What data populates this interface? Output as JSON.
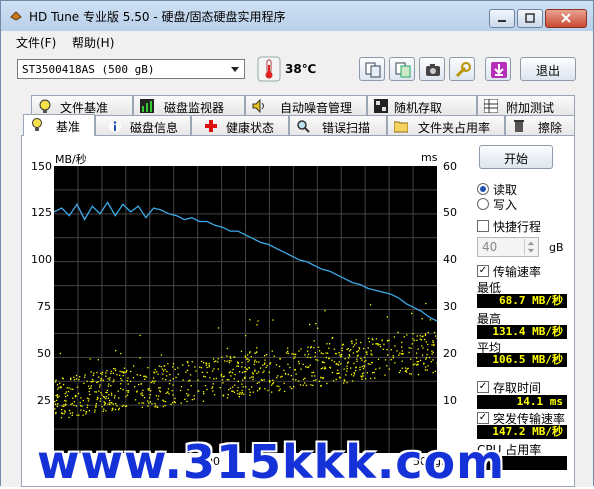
{
  "window": {
    "title": "HD Tune 专业版 5.50 - 硬盘/固态硬盘实用程序"
  },
  "menu": [
    "文件(F)",
    "帮助(H)"
  ],
  "toolbar": {
    "drive": "ST3500418AS (500 gB)",
    "temperature": "38℃",
    "exit_label": "退出",
    "icons": [
      "copy-info-icon",
      "copy-screen-icon",
      "screenshot-icon",
      "options-icon",
      "save-icon"
    ]
  },
  "tabs_row1": [
    "文件基准",
    "磁盘监视器",
    "自动噪音管理",
    "随机存取",
    "附加测试"
  ],
  "tabs_row2": [
    "基准",
    "磁盘信息",
    "健康状态",
    "错误扫描",
    "文件夹占用率",
    "擦除"
  ],
  "active_tab": "基准",
  "chart": {
    "left_unit": "MB/秒",
    "right_unit": "ms",
    "left_ticks": [
      "150",
      "125",
      "100",
      "75",
      "50",
      "25"
    ],
    "right_ticks": [
      "60",
      "50",
      "40",
      "30",
      "20",
      "10"
    ],
    "x_ticks": [
      "50",
      "200",
      "500gB"
    ]
  },
  "chart_data": {
    "type": "line",
    "x_range_gb": [
      0,
      500
    ],
    "ylim_left_mbps": [
      0,
      150
    ],
    "ylim_right_ms": [
      0,
      60
    ],
    "series": [
      {
        "axis": "left",
        "color": "#3ea9e8",
        "x": [
          0,
          10,
          20,
          30,
          40,
          50,
          60,
          70,
          80,
          90,
          100,
          110,
          120,
          130,
          140,
          150,
          160,
          170,
          180,
          190,
          200,
          210,
          220,
          230,
          240,
          250,
          260,
          270,
          280,
          290,
          300,
          310,
          320,
          330,
          340,
          350,
          360,
          370,
          380,
          390,
          400,
          410,
          420,
          430,
          440,
          450,
          460,
          470,
          480,
          490,
          500
        ],
        "values": [
          126,
          128,
          124,
          130,
          122,
          129,
          125,
          131,
          124,
          130,
          126,
          129,
          123,
          128,
          127,
          125,
          124,
          122,
          123,
          121,
          121,
          119,
          118,
          116,
          116,
          114,
          112,
          110,
          109,
          107,
          105,
          103,
          101,
          100,
          98,
          96,
          95,
          93,
          91,
          89,
          88,
          86,
          85,
          84,
          83,
          81,
          78,
          76,
          74,
          71,
          69
        ]
      },
      {
        "axis": "right",
        "color": "#ffff00",
        "type": "scatter",
        "x": [
          0,
          25,
          50,
          75,
          100,
          125,
          150,
          175,
          200,
          225,
          250,
          275,
          300,
          325,
          350,
          375,
          400,
          425,
          450,
          475,
          500
        ],
        "values": [
          11,
          12,
          13,
          13.5,
          14,
          14,
          14.5,
          15,
          15.5,
          16,
          16.5,
          17,
          17.5,
          18,
          18.5,
          19,
          19.5,
          20,
          20.5,
          21,
          21.5
        ]
      }
    ]
  },
  "controls": {
    "start_label": "开始",
    "read_label": "读取",
    "write_label": "写入",
    "quick_label": "快捷行程",
    "quick_value": "40",
    "quick_unit": "gB",
    "transfer_label": "传输速率",
    "min_label": "最低",
    "min_value": "68.7 MB/秒",
    "max_label": "最高",
    "max_value": "131.4 MB/秒",
    "avg_label": "平均",
    "avg_value": "106.5 MB/秒",
    "access_label": "存取时间",
    "access_value": "14.1 ms",
    "burst_label": "突发传输速率",
    "burst_value": "147.2 MB/秒",
    "cpu_label": "CPU 占用率"
  },
  "watermark": "www.315kkk.com"
}
